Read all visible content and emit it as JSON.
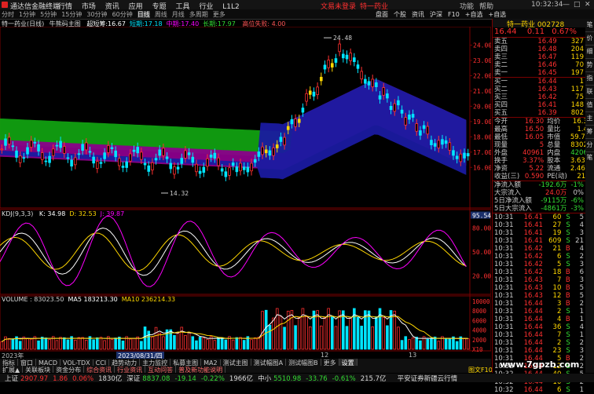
{
  "app": {
    "title": "通达信金融终端",
    "menu": [
      "行情",
      "市场",
      "资讯",
      "应用",
      "专题",
      "工具",
      "行业",
      "L1L2"
    ],
    "status_center": "文易未登录",
    "status_right": "特一药业",
    "right_tools": [
      "功能",
      "帮助"
    ],
    "time": "10:32:34",
    "window_buttons": [
      "—",
      "□",
      "✕"
    ]
  },
  "periods": {
    "items": [
      "分时",
      "1分钟",
      "5分钟",
      "15分钟",
      "30分钟",
      "60分钟",
      "日线",
      "周线",
      "月线",
      "多周期",
      "更多"
    ],
    "active": "日线"
  },
  "top_right_tabs": [
    "盘面",
    "个股",
    "资讯",
    "沪深",
    "F10",
    "+自选",
    "+自选"
  ],
  "chart_header": {
    "stock": "特一药业(日线)",
    "indicator": "牛熊码主图",
    "fields": [
      {
        "label": "超短筹:",
        "value": "16.67",
        "color": "#ffffff"
      },
      {
        "label": "短期:",
        "value": "17.18",
        "color": "#00e5ff"
      },
      {
        "label": "中期:",
        "value": "17.40",
        "color": "#ff00ff"
      },
      {
        "label": "长期:",
        "value": "17.97",
        "color": "#33dd33"
      }
    ],
    "note": "高位失败: 4.00"
  },
  "chart_data": [
    {
      "type": "candlestick",
      "title": "牛熊码主图",
      "ylim": [
        13.6,
        25.0
      ],
      "y_ticks": [
        "24.00",
        "23.00",
        "22.00",
        "21.00",
        "20.00",
        "19.00",
        "18.00",
        "17.00",
        "16.00"
      ],
      "annotations": [
        {
          "text": "24.48",
          "where": "high"
        },
        {
          "text": "14.32",
          "where": "low"
        }
      ]
    },
    {
      "type": "line",
      "title": "KDJ(9,3,3)",
      "series": [
        {
          "name": "K",
          "value": "34.98",
          "color": "#ffffff"
        },
        {
          "name": "D",
          "value": "32.53",
          "color": "#ffd700"
        },
        {
          "name": "J",
          "value": "39.87",
          "color": "#ff00ff"
        }
      ],
      "ylim": [
        0,
        100
      ],
      "y_ticks": [
        "95.54",
        "80.00",
        "50.00",
        "20.00"
      ]
    },
    {
      "type": "bar",
      "title": "VOLUME",
      "series": [
        {
          "name": "VOLUME",
          "value": "83023.50",
          "color": "#cccccc"
        },
        {
          "name": "MA5",
          "value": "183213.30",
          "color": "#ffffff"
        },
        {
          "name": "MA10",
          "value": "236214.33",
          "color": "#ffd700"
        }
      ],
      "y_ticks": [
        "10000",
        "8000",
        "6000",
        "4000",
        "2000",
        "X10"
      ]
    }
  ],
  "x_axis": {
    "left": "2023年",
    "mid": "2023/08/31/四",
    "r1": "12",
    "r2": "13"
  },
  "bottom_tabs": [
    "指标",
    "窗口",
    "MACD",
    "VOL-TDX",
    "CCI",
    "趋势动力",
    "主力监控",
    "私募主图",
    "MA2",
    "测试主图",
    "测试幅图A",
    "测试幅图B",
    "更多",
    "设置"
  ],
  "bottom_tabs2": [
    "扩展▲",
    "关联板块",
    "资金分布",
    "综合资讯",
    "行业资讯",
    "互动问答",
    "普及新功能说明"
  ],
  "quote_panel": {
    "name": "特一药业",
    "code": "002728",
    "price": "16.44",
    "change": "0.11",
    "pct": "0.67%",
    "asks": [
      {
        "label": "卖五",
        "price": "16.49",
        "vol": "327"
      },
      {
        "label": "卖四",
        "price": "16.48",
        "vol": "204"
      },
      {
        "label": "卖三",
        "price": "16.47",
        "vol": "119"
      },
      {
        "label": "卖二",
        "price": "16.46",
        "vol": "70"
      },
      {
        "label": "卖一",
        "price": "16.45",
        "vol": "197"
      }
    ],
    "bids": [
      {
        "label": "买一",
        "price": "16.44",
        "vol": "1"
      },
      {
        "label": "买二",
        "price": "16.43",
        "vol": "117"
      },
      {
        "label": "买三",
        "price": "16.42",
        "vol": "75"
      },
      {
        "label": "买四",
        "price": "16.41",
        "vol": "148"
      },
      {
        "label": "买五",
        "price": "16.39",
        "vol": "802"
      }
    ],
    "stats": [
      [
        "今开",
        "16.30",
        "均价",
        "16.33"
      ],
      [
        "最高",
        "16.50",
        "量比",
        "1.48"
      ],
      [
        "最低",
        "16.05",
        "市值",
        "59.7亿"
      ],
      [
        "现量",
        "5",
        "总量",
        "83024"
      ],
      [
        "外盘",
        "40961",
        "内盘",
        "42063"
      ],
      [
        "换手",
        "3.37%",
        "股本",
        "3.63亿"
      ],
      [
        "净资",
        "5.22",
        "流通",
        "2.46亿"
      ],
      [
        "收益(三)",
        "0.590",
        "PE(动)",
        "21.0"
      ]
    ],
    "flows": [
      {
        "label": "净流入额",
        "value": "-192.6万",
        "pct": "-1%"
      },
      {
        "label": "大宗流入",
        "value": "24.0万",
        "pct": "0%"
      },
      {
        "label": "5日净流入额",
        "value": "-9115万",
        "pct": "-6%"
      },
      {
        "label": "5日大宗流入",
        "value": "-4861万",
        "pct": "-3%"
      }
    ],
    "ticks": [
      [
        "10:31",
        "16.41",
        "60",
        "S",
        "5"
      ],
      [
        "10:31",
        "16.41",
        "27",
        "S",
        "4"
      ],
      [
        "10:31",
        "16.41",
        "19",
        "S",
        "3"
      ],
      [
        "10:31",
        "16.41",
        "609",
        "S",
        "21"
      ],
      [
        "10:31",
        "16.42",
        "21",
        "B",
        "4"
      ],
      [
        "10:31",
        "16.42",
        "6",
        "S",
        "2"
      ],
      [
        "10:31",
        "16.42",
        "5",
        "S",
        "3"
      ],
      [
        "10:31",
        "16.42",
        "18",
        "B",
        "6"
      ],
      [
        "10:31",
        "16.43",
        "7",
        "B",
        "3"
      ],
      [
        "10:31",
        "16.43",
        "10",
        "B",
        "5"
      ],
      [
        "10:31",
        "16.43",
        "12",
        "B",
        "5"
      ],
      [
        "10:31",
        "16.44",
        "3",
        "B",
        "2"
      ],
      [
        "10:31",
        "16.44",
        "2",
        "S",
        "1"
      ],
      [
        "10:31",
        "16.44",
        "4",
        "B",
        "1"
      ],
      [
        "10:31",
        "16.44",
        "36",
        "S",
        "4"
      ],
      [
        "10:31",
        "16.44",
        "7",
        "S",
        "1"
      ],
      [
        "10:31",
        "16.44",
        "2",
        "S",
        "2"
      ],
      [
        "10:31",
        "16.44",
        "23",
        "S",
        "3"
      ],
      [
        "10:31",
        "16.44",
        "5",
        "B",
        "2"
      ],
      [
        "10:32",
        "16.44",
        "12",
        "S",
        "2"
      ],
      [
        "10:32",
        "16.44",
        "40",
        "S",
        "5"
      ],
      [
        "10:32",
        "16.44",
        "10",
        "S",
        "2"
      ],
      [
        "10:32",
        "16.44",
        "6",
        "S",
        "1"
      ]
    ],
    "tabs": [
      "笔",
      "价",
      "细",
      "势",
      "指",
      "联",
      "值",
      "主",
      "筹",
      "分笔"
    ]
  },
  "status_bar": [
    {
      "name": "上证",
      "price": "2907.97",
      "chg": "1.86",
      "pct": "0.06%",
      "amt": "1830亿"
    },
    {
      "name": "深证",
      "price": "8837.08",
      "chg": "-19.14",
      "pct": "-0.22%",
      "amt": "1966亿"
    },
    {
      "name": "中小",
      "price": "5510.98",
      "chg": "-33.76",
      "pct": "-0.61%",
      "amt": "215.7亿"
    }
  ],
  "status_extra": "平安证券新疆云行情",
  "watermark": "www.7gpzb.com",
  "f10_label": "图文F10"
}
